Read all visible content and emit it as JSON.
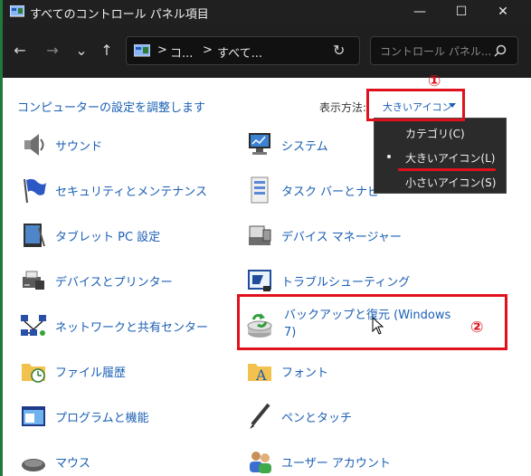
{
  "window": {
    "title": "すべてのコントロール パネル項目",
    "controls": {
      "minimize": "—",
      "maximize": "☐",
      "close": "✕"
    }
  },
  "nav": {
    "back": "←",
    "forward": "→",
    "recent": "⌄",
    "up": "↑",
    "address": {
      "crumb1": "コ...",
      "crumb2": "すべて...",
      "sep": ">",
      "refresh": "↻"
    },
    "search_placeholder": "コントロール パネル..."
  },
  "header": {
    "title": "コンピューターの設定を調整します",
    "view_by_label": "表示方法:",
    "view_by_value": "大きいアイコン"
  },
  "annotations": {
    "one": "①",
    "two": "②"
  },
  "dropdown": {
    "items": [
      "カテゴリ(C)",
      "大きいアイコン(L)",
      "小さいアイコン(S)"
    ],
    "selected": "大きいアイコン(L)"
  },
  "items": {
    "left": [
      "サウンド",
      "セキュリティとメンテナンス",
      "タブレット PC 設定",
      "デバイスとプリンター",
      "ネットワークと共有センター",
      "ファイル履歴",
      "プログラムと機能",
      "マウス"
    ],
    "right": [
      "システム",
      "タスク バーとナビ",
      "デバイス マネージャー",
      "トラブルシューティング",
      "バックアップと復元 (Windows 7)",
      "フォント",
      "ペンとタッチ",
      "ユーザー アカウント"
    ]
  },
  "colors": {
    "accent": "#1a5fb4",
    "annotation_red": "#e0111c",
    "titlebar": "#202020"
  }
}
